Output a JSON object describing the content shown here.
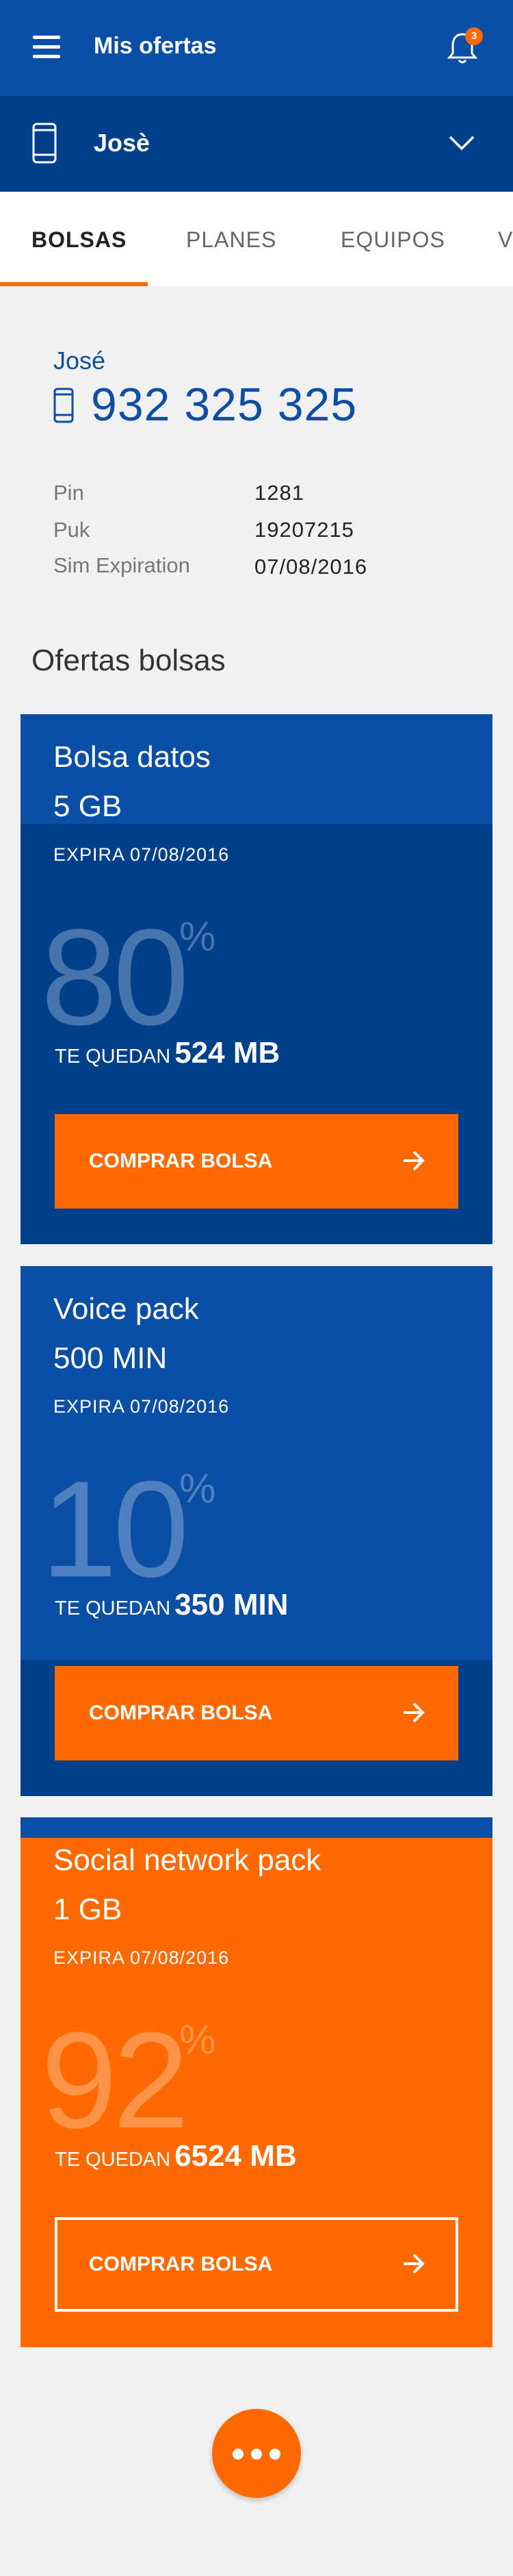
{
  "header": {
    "title": "Mis ofertas",
    "notification_count": "3"
  },
  "user_bar": {
    "name": "Josè"
  },
  "tabs": [
    {
      "label": "BOLSAS",
      "active": true
    },
    {
      "label": "PLANES"
    },
    {
      "label": "EQUIPOS"
    },
    {
      "label": "V"
    }
  ],
  "account": {
    "name": "José",
    "number": "932 325 325",
    "rows": [
      {
        "label": "Pin",
        "value": "1281"
      },
      {
        "label": "Puk",
        "value": "19207215"
      },
      {
        "label": "Sim Expiration",
        "value": "07/08/2016"
      }
    ]
  },
  "section_title": "Ofertas bolsas",
  "cards": [
    {
      "title": "Bolsa datos",
      "amount": "5 GB",
      "expiry": "EXPIRA 07/08/2016",
      "percent": "80",
      "percent_sign": "%",
      "remaining_prefix": "TE QUEDAN",
      "remaining_value": "524 MB",
      "button": "COMPRAR BOLSA",
      "level": 0.8,
      "colors": {
        "top": "#0a4ea6",
        "bottom": "#003f8a",
        "button": "#ff6a00"
      }
    },
    {
      "title": "Voice pack",
      "amount": "500 MIN",
      "expiry": "EXPIRA 07/08/2016",
      "percent": "10",
      "percent_sign": "%",
      "remaining_prefix": "TE QUEDAN",
      "remaining_value": "350 MIN",
      "button": "COMPRAR BOLSA",
      "level": 0.1,
      "colors": {
        "top": "#0a4ea6",
        "bottom": "#003f8a",
        "button": "#ff6a00"
      }
    },
    {
      "title": "Social network pack",
      "amount": "1 GB",
      "expiry": "EXPIRA 07/08/2016",
      "percent": "92",
      "percent_sign": "%",
      "remaining_prefix": "TE QUEDAN",
      "remaining_value": "6524 MB",
      "button": "COMPRAR BOLSA",
      "level": 0.92,
      "colors": {
        "top": "#0a4ea6",
        "bottom": "#ff6a00",
        "button": "outline-white"
      }
    }
  ]
}
